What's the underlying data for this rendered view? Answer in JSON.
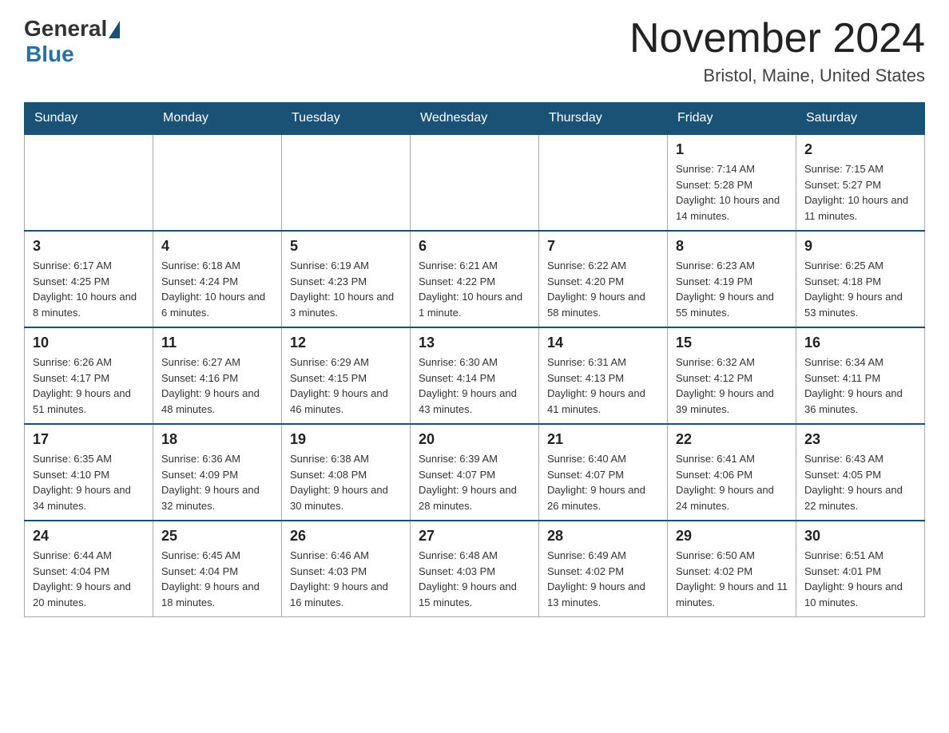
{
  "header": {
    "logo": {
      "general": "General",
      "blue": "Blue"
    },
    "title": "November 2024",
    "subtitle": "Bristol, Maine, United States"
  },
  "calendar": {
    "days_of_week": [
      "Sunday",
      "Monday",
      "Tuesday",
      "Wednesday",
      "Thursday",
      "Friday",
      "Saturday"
    ],
    "weeks": [
      [
        {
          "day": "",
          "info": ""
        },
        {
          "day": "",
          "info": ""
        },
        {
          "day": "",
          "info": ""
        },
        {
          "day": "",
          "info": ""
        },
        {
          "day": "",
          "info": ""
        },
        {
          "day": "1",
          "info": "Sunrise: 7:14 AM\nSunset: 5:28 PM\nDaylight: 10 hours and 14 minutes."
        },
        {
          "day": "2",
          "info": "Sunrise: 7:15 AM\nSunset: 5:27 PM\nDaylight: 10 hours and 11 minutes."
        }
      ],
      [
        {
          "day": "3",
          "info": "Sunrise: 6:17 AM\nSunset: 4:25 PM\nDaylight: 10 hours and 8 minutes."
        },
        {
          "day": "4",
          "info": "Sunrise: 6:18 AM\nSunset: 4:24 PM\nDaylight: 10 hours and 6 minutes."
        },
        {
          "day": "5",
          "info": "Sunrise: 6:19 AM\nSunset: 4:23 PM\nDaylight: 10 hours and 3 minutes."
        },
        {
          "day": "6",
          "info": "Sunrise: 6:21 AM\nSunset: 4:22 PM\nDaylight: 10 hours and 1 minute."
        },
        {
          "day": "7",
          "info": "Sunrise: 6:22 AM\nSunset: 4:20 PM\nDaylight: 9 hours and 58 minutes."
        },
        {
          "day": "8",
          "info": "Sunrise: 6:23 AM\nSunset: 4:19 PM\nDaylight: 9 hours and 55 minutes."
        },
        {
          "day": "9",
          "info": "Sunrise: 6:25 AM\nSunset: 4:18 PM\nDaylight: 9 hours and 53 minutes."
        }
      ],
      [
        {
          "day": "10",
          "info": "Sunrise: 6:26 AM\nSunset: 4:17 PM\nDaylight: 9 hours and 51 minutes."
        },
        {
          "day": "11",
          "info": "Sunrise: 6:27 AM\nSunset: 4:16 PM\nDaylight: 9 hours and 48 minutes."
        },
        {
          "day": "12",
          "info": "Sunrise: 6:29 AM\nSunset: 4:15 PM\nDaylight: 9 hours and 46 minutes."
        },
        {
          "day": "13",
          "info": "Sunrise: 6:30 AM\nSunset: 4:14 PM\nDaylight: 9 hours and 43 minutes."
        },
        {
          "day": "14",
          "info": "Sunrise: 6:31 AM\nSunset: 4:13 PM\nDaylight: 9 hours and 41 minutes."
        },
        {
          "day": "15",
          "info": "Sunrise: 6:32 AM\nSunset: 4:12 PM\nDaylight: 9 hours and 39 minutes."
        },
        {
          "day": "16",
          "info": "Sunrise: 6:34 AM\nSunset: 4:11 PM\nDaylight: 9 hours and 36 minutes."
        }
      ],
      [
        {
          "day": "17",
          "info": "Sunrise: 6:35 AM\nSunset: 4:10 PM\nDaylight: 9 hours and 34 minutes."
        },
        {
          "day": "18",
          "info": "Sunrise: 6:36 AM\nSunset: 4:09 PM\nDaylight: 9 hours and 32 minutes."
        },
        {
          "day": "19",
          "info": "Sunrise: 6:38 AM\nSunset: 4:08 PM\nDaylight: 9 hours and 30 minutes."
        },
        {
          "day": "20",
          "info": "Sunrise: 6:39 AM\nSunset: 4:07 PM\nDaylight: 9 hours and 28 minutes."
        },
        {
          "day": "21",
          "info": "Sunrise: 6:40 AM\nSunset: 4:07 PM\nDaylight: 9 hours and 26 minutes."
        },
        {
          "day": "22",
          "info": "Sunrise: 6:41 AM\nSunset: 4:06 PM\nDaylight: 9 hours and 24 minutes."
        },
        {
          "day": "23",
          "info": "Sunrise: 6:43 AM\nSunset: 4:05 PM\nDaylight: 9 hours and 22 minutes."
        }
      ],
      [
        {
          "day": "24",
          "info": "Sunrise: 6:44 AM\nSunset: 4:04 PM\nDaylight: 9 hours and 20 minutes."
        },
        {
          "day": "25",
          "info": "Sunrise: 6:45 AM\nSunset: 4:04 PM\nDaylight: 9 hours and 18 minutes."
        },
        {
          "day": "26",
          "info": "Sunrise: 6:46 AM\nSunset: 4:03 PM\nDaylight: 9 hours and 16 minutes."
        },
        {
          "day": "27",
          "info": "Sunrise: 6:48 AM\nSunset: 4:03 PM\nDaylight: 9 hours and 15 minutes."
        },
        {
          "day": "28",
          "info": "Sunrise: 6:49 AM\nSunset: 4:02 PM\nDaylight: 9 hours and 13 minutes."
        },
        {
          "day": "29",
          "info": "Sunrise: 6:50 AM\nSunset: 4:02 PM\nDaylight: 9 hours and 11 minutes."
        },
        {
          "day": "30",
          "info": "Sunrise: 6:51 AM\nSunset: 4:01 PM\nDaylight: 9 hours and 10 minutes."
        }
      ]
    ]
  }
}
